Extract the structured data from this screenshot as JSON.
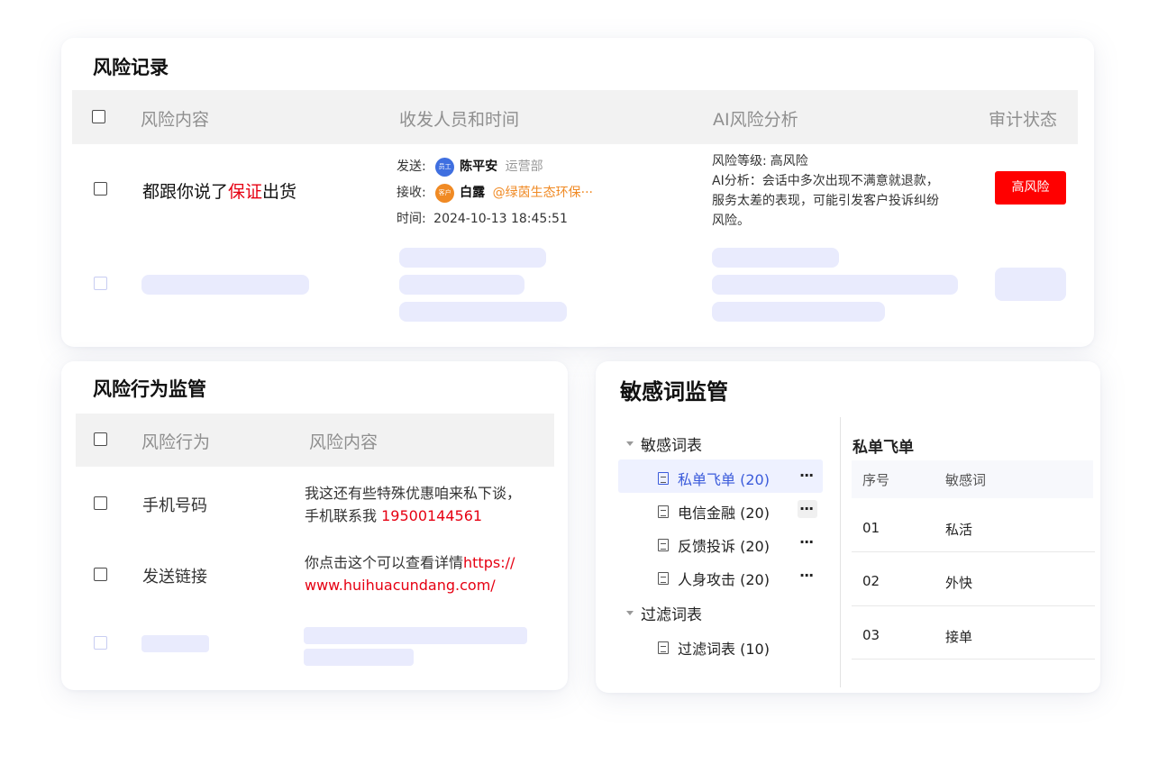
{
  "risk_records": {
    "title": "风险记录",
    "headers": {
      "content": "风险内容",
      "people_time": "收发人员和时间",
      "ai": "AI风险分析",
      "status": "审计状态"
    },
    "row": {
      "content_pre": "都跟你说了",
      "content_highlight": "保证",
      "content_post": "出货",
      "send_label": "发送:",
      "sender_badge": "员工",
      "sender_name": "陈平安",
      "sender_dept": "运营部",
      "recv_label": "接收:",
      "receiver_badge": "客户",
      "receiver_name": "白露",
      "receiver_org": "@绿茵生态环保···",
      "time_label": "时间:",
      "time_value": "2024-10-13 18:45:51",
      "ai_level_label": "风险等级:",
      "ai_level_value": "高风险",
      "ai_analysis_1": "AI分析：会话中多次出现不满意就退款，",
      "ai_analysis_2": "服务太差的表现，可能引发客户投诉纠纷",
      "ai_analysis_3": "风险。",
      "status_badge": "高风险"
    },
    "colors": {
      "sender_avatar": "#3f6fe0",
      "receiver_avatar": "#f08a24",
      "status_badge": "#ff0000"
    }
  },
  "risk_behavior": {
    "title": "风险行为监管",
    "headers": {
      "behavior": "风险行为",
      "content": "风险内容"
    },
    "rows": [
      {
        "behavior": "手机号码",
        "content_1": "我这还有些特殊优惠咱来私下谈，",
        "content_2_pre": "手机联系我 ",
        "content_2_red": "19500144561"
      },
      {
        "behavior": "发送链接",
        "content_1_pre": "你点击这个可以查看详情",
        "content_1_red": "https://",
        "content_2_red": "www.huihuacundang.com/"
      }
    ]
  },
  "sensitive": {
    "title": "敏感词监管",
    "tree": {
      "group1": "敏感词表",
      "items": [
        "私单飞单 (20)",
        "电信金融 (20)",
        "反馈投诉 (20)",
        "人身攻击 (20)"
      ],
      "more": "···",
      "group2": "过滤词表",
      "filter_item": "过滤词表 (10)"
    },
    "detail": {
      "title": "私单飞单",
      "headers": {
        "index": "序号",
        "word": "敏感词"
      },
      "rows": [
        {
          "index": "01",
          "word": "私活"
        },
        {
          "index": "02",
          "word": "外快"
        },
        {
          "index": "03",
          "word": "接单"
        }
      ]
    },
    "colors": {
      "selected_bg": "#eef1ff",
      "selected_text": "#3b5bdb"
    }
  }
}
